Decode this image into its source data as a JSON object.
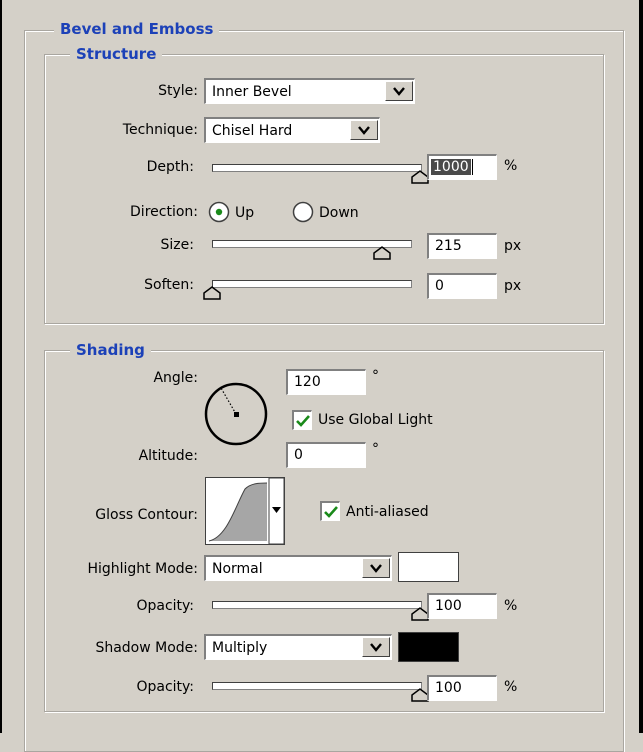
{
  "bevel_and_emboss": {
    "title": "Bevel and Emboss",
    "structure": {
      "title": "Structure",
      "style_label": "Style:",
      "style_value": "Inner Bevel",
      "technique_label": "Technique:",
      "technique_value": "Chisel Hard",
      "depth_label": "Depth:",
      "depth_value": "1000",
      "depth_unit": "%",
      "depth_slider_fraction": 1.0,
      "direction_label": "Direction:",
      "direction_up": "Up",
      "direction_down": "Down",
      "direction_selected": "Up",
      "size_label": "Size:",
      "size_value": "215",
      "size_unit": "px",
      "size_slider_fraction": 0.86,
      "soften_label": "Soften:",
      "soften_value": "0",
      "soften_unit": "px",
      "soften_slider_fraction": 0.0
    },
    "shading": {
      "title": "Shading",
      "angle_label": "Angle:",
      "angle_value": "120",
      "angle_unit": "°",
      "use_global_light_label": "Use Global Light",
      "use_global_light_checked": true,
      "altitude_label": "Altitude:",
      "altitude_value": "0",
      "altitude_unit": "°",
      "gloss_contour_label": "Gloss Contour:",
      "anti_aliased_label": "Anti-aliased",
      "anti_aliased_checked": true,
      "highlight_mode_label": "Highlight Mode:",
      "highlight_mode_value": "Normal",
      "highlight_color": "#ffffff",
      "highlight_opacity_label": "Opacity:",
      "highlight_opacity_value": "100",
      "highlight_opacity_unit": "%",
      "highlight_opacity_fraction": 1.0,
      "shadow_mode_label": "Shadow Mode:",
      "shadow_mode_value": "Multiply",
      "shadow_color": "#000000",
      "shadow_opacity_label": "Opacity:",
      "shadow_opacity_value": "100",
      "shadow_opacity_unit": "%",
      "shadow_opacity_fraction": 1.0
    }
  },
  "colors": {
    "panel_bg": "#d4d0c8",
    "title_blue": "#1c41b8",
    "check_green": "#1a8a1a"
  },
  "icons": {
    "dropdown": "chevron-down-icon",
    "check": "check-icon"
  }
}
